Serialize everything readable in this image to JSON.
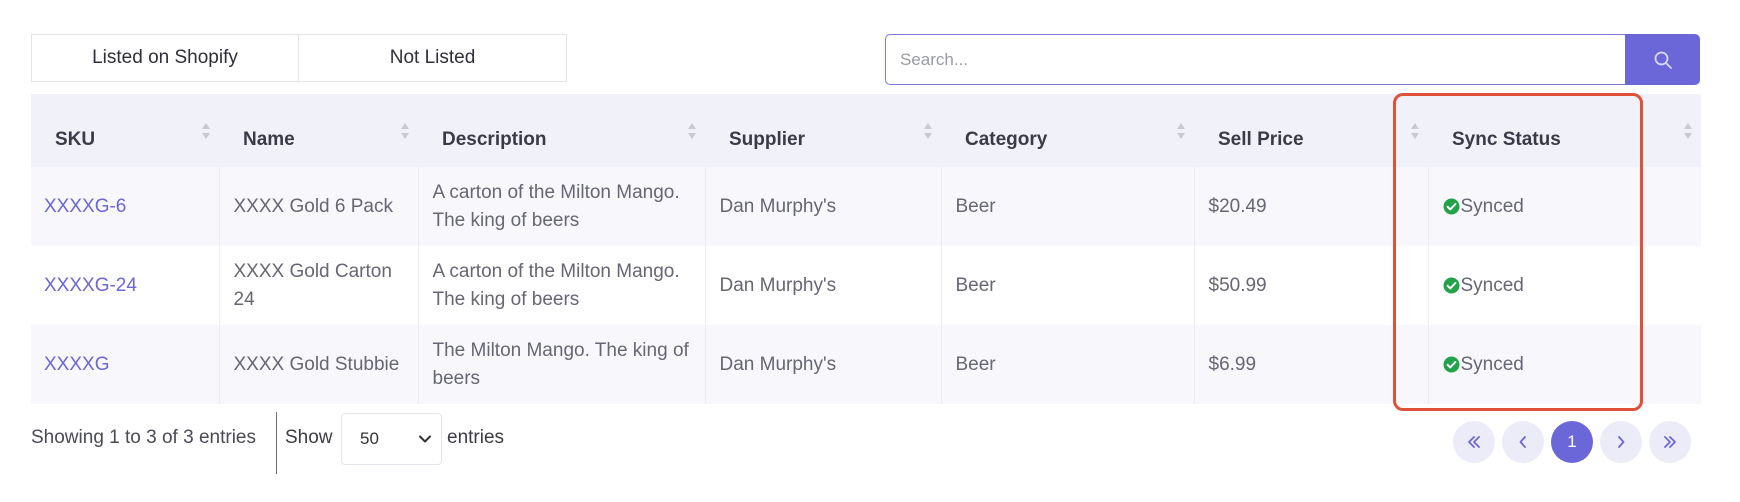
{
  "filters": {
    "listed_label": "Listed on Shopify",
    "not_listed_label": "Not Listed"
  },
  "search": {
    "placeholder": "Search..."
  },
  "table": {
    "headers": [
      "SKU",
      "Name",
      "Description",
      "Supplier",
      "Category",
      "Sell Price",
      "Sync Status"
    ],
    "rows": [
      {
        "sku": "XXXXG-6",
        "name": "XXXX Gold 6 Pack",
        "description": "A carton of the Milton Mango. The king of beers",
        "supplier": "Dan Murphy's",
        "category": "Beer",
        "sell_price": "$20.49",
        "sync_status": "Synced"
      },
      {
        "sku": "XXXXG-24",
        "name": "XXXX Gold Carton 24",
        "description": "A carton of the Milton Mango. The king of beers",
        "supplier": "Dan Murphy's",
        "category": "Beer",
        "sell_price": "$50.99",
        "sync_status": "Synced"
      },
      {
        "sku": "XXXXG",
        "name": "XXXX Gold Stubbie",
        "description": "The Milton Mango. The king of beers",
        "supplier": "Dan Murphy's",
        "category": "Beer",
        "sell_price": "$6.99",
        "sync_status": "Synced"
      }
    ]
  },
  "footer": {
    "info": "Showing 1 to 3 of 3 entries",
    "show_label": "Show",
    "page_size": "50",
    "entries_label": "entries"
  },
  "pagination": {
    "current_page": "1"
  },
  "colors": {
    "accent": "#6c67d8",
    "success": "#22a34a",
    "highlight": "#e0513a"
  }
}
